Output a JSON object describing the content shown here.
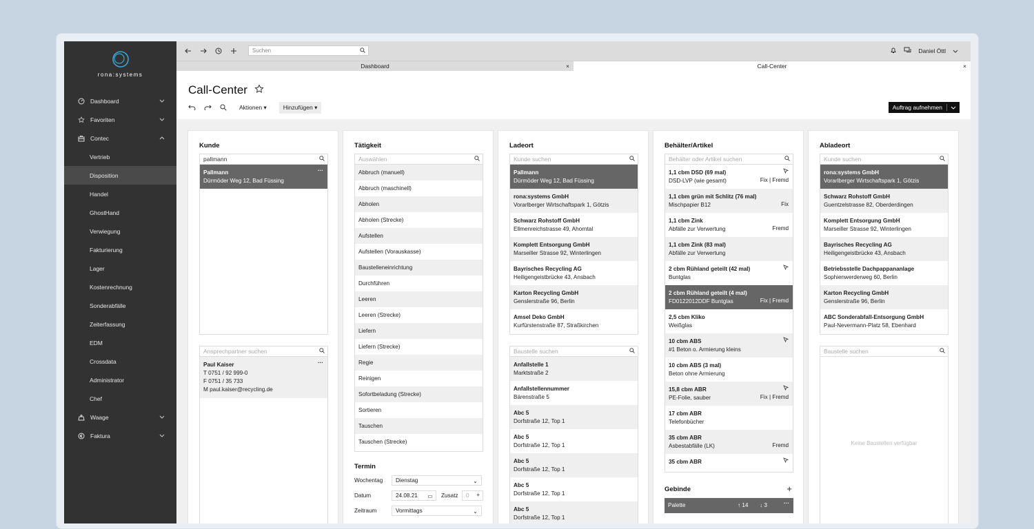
{
  "sidebar": {
    "brand": "rona:systems",
    "items": [
      {
        "label": "Dashboard",
        "icon": "dashboard-icon",
        "chev": "down"
      },
      {
        "label": "Favoriten",
        "icon": "star-icon",
        "chev": "down"
      },
      {
        "label": "Contec",
        "icon": "briefcase-icon",
        "chev": "up"
      },
      {
        "label": "Vertrieb",
        "sub": true
      },
      {
        "label": "Disposition",
        "sub": true,
        "active": true
      },
      {
        "label": "Handel",
        "sub": true
      },
      {
        "label": "GhostHand",
        "sub": true
      },
      {
        "label": "Verwiegung",
        "sub": true
      },
      {
        "label": "Fakturierung",
        "sub": true
      },
      {
        "label": "Lager",
        "sub": true
      },
      {
        "label": "Kostenrechnung",
        "sub": true
      },
      {
        "label": "Sonderabfälle",
        "sub": true
      },
      {
        "label": "Zeiterfassung",
        "sub": true
      },
      {
        "label": "EDM",
        "sub": true
      },
      {
        "label": "Crossdata",
        "sub": true
      },
      {
        "label": "Administrator",
        "sub": true
      },
      {
        "label": "Chef",
        "sub": true
      },
      {
        "label": "Waage",
        "icon": "scale-icon",
        "chev": "down"
      },
      {
        "label": "Faktura",
        "icon": "euro-icon",
        "chev": "down"
      }
    ]
  },
  "topbar": {
    "search_placeholder": "Suchen",
    "user": "Daniel Öttl"
  },
  "tabs": [
    {
      "label": "Dashboard"
    },
    {
      "label": "Call-Center"
    }
  ],
  "page": {
    "title": "Call-Center",
    "actions": "Aktionen",
    "add": "Hinzufügen",
    "primary": "Auftrag aufnehmen"
  },
  "kunde": {
    "title": "Kunde",
    "search": "pallmann",
    "result": {
      "name": "Pallmann",
      "addr": "Dürmöder Weg 12, Bad Füssing"
    },
    "contact_placeholder": "Ansprechpartner suchen",
    "contact": {
      "name": "Paul Kaiser",
      "t": "T 0751 / 92 999-0",
      "f": "F 0751 / 35 733",
      "m": "M paul.kaiser@recycling.de"
    }
  },
  "taetigkeit": {
    "title": "Tätigkeit",
    "placeholder": "Auswählen",
    "items": [
      "Abbruch (manuell)",
      "Abbruch (maschinell)",
      "Abholen",
      "Abholen (Strecke)",
      "Aufstellen",
      "Aufstellen (Vorauskasse)",
      "Baustelleneinrichtung",
      "Durchführen",
      "Leeren",
      "Leeren (Strecke)",
      "Liefern",
      "Liefern (Strecke)",
      "Regie",
      "Reinigen",
      "Sofortbeladung (Strecke)",
      "Sortieren",
      "Tauschen",
      "Tauschen (Strecke)"
    ],
    "termin": {
      "title": "Termin",
      "wochentag_label": "Wochentag",
      "wochentag": "Dienstag",
      "datum_label": "Datum",
      "datum": "24.08.21",
      "zusatz_label": "Zusatz",
      "zusatz": "0",
      "zeitraum_label": "Zeitraum",
      "zeitraum": "Vormittags"
    }
  },
  "ladeort": {
    "title": "Ladeort",
    "placeholder": "Kunde suchen",
    "items": [
      {
        "name": "Pallmann",
        "addr": "Dürmöder Weg 12, Bad Füssing"
      },
      {
        "name": "rona:systems GmbH",
        "addr": "Vorarlberger Wirtschaftspark 1, Götzis"
      },
      {
        "name": "Schwarz Rohstoff GmbH",
        "addr": "Ellmenreichstrasse 49, Ahorntal"
      },
      {
        "name": "Komplett Entsorgung GmbH",
        "addr": "Marseiller Strasse 92, Winterlingen"
      },
      {
        "name": "Bayrisches Recycling AG",
        "addr": "Heiligengeistbrücke 43, Ansbach"
      },
      {
        "name": "Karton Recycling GmbH",
        "addr": "Genslerstraße 96, Berlin"
      },
      {
        "name": "Amsel Deko GmbH",
        "addr": "Kurfürstenstraße 87, Straßkirchen"
      }
    ],
    "baustelle_placeholder": "Baustelle suchen",
    "baustellen": [
      {
        "name": "Anfallstelle 1",
        "addr": "Marktstraße 2"
      },
      {
        "name": "Anfallstellennummer",
        "addr": "Bärenstraße 5"
      },
      {
        "name": "Abc 5",
        "addr": "Dorfstraße 12, Top 1"
      },
      {
        "name": "Abc 5",
        "addr": "Dorfstraße 12, Top 1"
      },
      {
        "name": "Abc 5",
        "addr": "Dorfstraße 12, Top 1"
      },
      {
        "name": "Abc 5",
        "addr": "Dorfstraße 12, Top 1"
      },
      {
        "name": "Abc 5",
        "addr": "Dorfstraße 12, Top 1"
      }
    ]
  },
  "behaelter": {
    "title": "Behälter/Artikel",
    "placeholder": "Behälter oder Artikel suchen",
    "items": [
      {
        "name": "1,1 cbm DSD (69 mal)",
        "sub": "DSD-LVP (wie gesamt)",
        "rt": "Fix | Fremd",
        "arrow": true
      },
      {
        "name": "1,1 cbm grün mit Schlitz (76 mal)",
        "sub": "Mischpapier B12",
        "rt": "Fix"
      },
      {
        "name": "1,1 cbm Zink",
        "sub": "Abfälle zur Verwertung",
        "rt": "Fremd"
      },
      {
        "name": "1,1 cbm Zink (83 mal)",
        "sub": "Abfälle zur Verwertung",
        "rt": ""
      },
      {
        "name": "2 cbm Rühland geteilt (42 mal)",
        "sub": "Buntglas",
        "rt": "",
        "arrow": true
      },
      {
        "name": "2 cbm Rühland geteilt (4 mal)",
        "sub": "FD0122012DDF Buntglas",
        "rt": "Fix | Fremd",
        "sel": true
      },
      {
        "name": "2,5 cbm Kliko",
        "sub": "Weißglas",
        "rt": ""
      },
      {
        "name": "10 cbm ABS",
        "sub": "#1 Beton o. Armierung kleins",
        "rt": "",
        "arrow": true
      },
      {
        "name": "10 cbm ABS (3 mal)",
        "sub": "Beton ohne Armierung",
        "rt": ""
      },
      {
        "name": "15,8 cbm ABR",
        "sub": "PE-Folie, sauber",
        "rt": "Fix | Fremd",
        "arrow": true
      },
      {
        "name": "17 cbm ABR",
        "sub": "Telefonbücher",
        "rt": ""
      },
      {
        "name": "35 cbm ABR",
        "sub": "Asbestabfälle (LK)",
        "rt": "Fremd"
      },
      {
        "name": "35 cbm ABR",
        "sub": "",
        "rt": "",
        "arrow": true
      }
    ],
    "gebinde": {
      "title": "Gebinde",
      "item": "Palette",
      "up": "↑ 14",
      "down": "↓ 3"
    }
  },
  "abladeort": {
    "title": "Abladeort",
    "placeholder": "Kunde suchen",
    "items": [
      {
        "name": "rona:systems GmbH",
        "addr": "Vorarlberger Wirtschaftspark 1, Götzis"
      },
      {
        "name": "Schwarz Rohstoff GmbH",
        "addr": "Guentzelstrasse 82, Oberderdingen"
      },
      {
        "name": "Komplett Entsorgung GmbH",
        "addr": "Marseiller Strasse 92, Winterlingen"
      },
      {
        "name": "Bayrisches Recycling AG",
        "addr": "Heiligengeistbrücke 43, Ansbach"
      },
      {
        "name": "Betriebsstelle Dachpappananlage",
        "addr": "Sophienwerderweg 60, Berlin"
      },
      {
        "name": "Karton Recycling GmbH",
        "addr": "Genslerstraße 96, Berlin"
      },
      {
        "name": "ABC Sonderabfall-Entsorgung GmbH",
        "addr": "Paul-Nevermann-Platz 58, Ebenhard"
      }
    ],
    "baustelle_placeholder": "Baustelle suchen",
    "empty": "Keine Baustellen verfügbar"
  }
}
